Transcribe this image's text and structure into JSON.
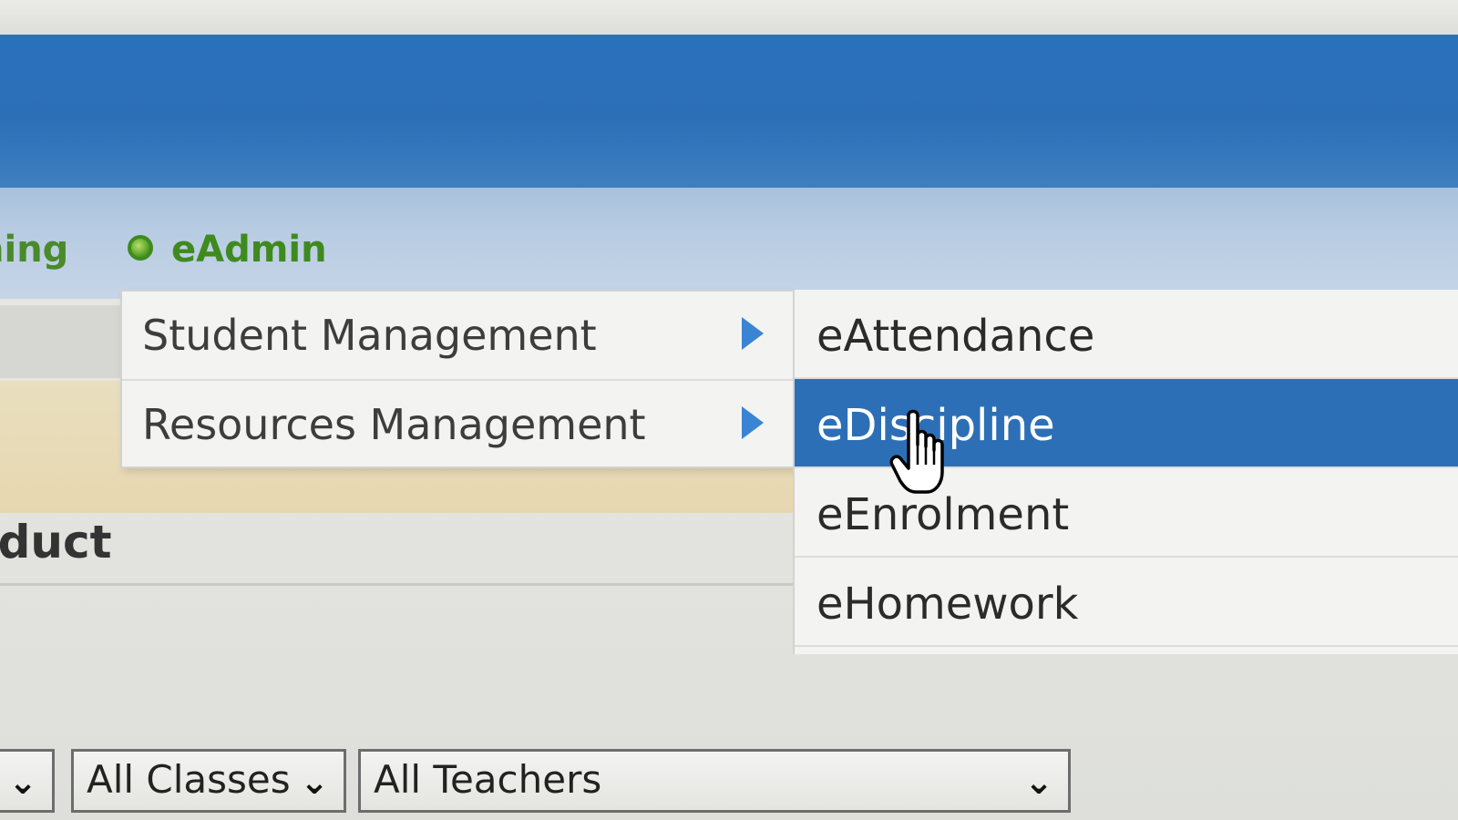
{
  "nav": {
    "prev_item_label": "ning",
    "active_item_label": "eAdmin",
    "active_item_icon": "green-circle-icon"
  },
  "menu": {
    "level1": [
      {
        "label": "Student Management",
        "has_submenu": true
      },
      {
        "label": "Resources Management",
        "has_submenu": true
      }
    ],
    "level2": [
      {
        "label": "eAttendance",
        "highlighted": false
      },
      {
        "label": "eDiscipline",
        "highlighted": true
      },
      {
        "label": "eEnrolment",
        "highlighted": false
      },
      {
        "label": "eHomework",
        "highlighted": false
      }
    ]
  },
  "page": {
    "heading": "nduct"
  },
  "filters": {
    "first_value": "",
    "classes_value": "All Classes",
    "teachers_value": "All Teachers"
  },
  "cursor": "hand-pointer-icon",
  "colors": {
    "banner_blue": "#2c6fb7",
    "nav_green": "#3f8a1e",
    "highlight_blue": "#2d6fb6",
    "arrow_blue": "#3a84d4"
  }
}
